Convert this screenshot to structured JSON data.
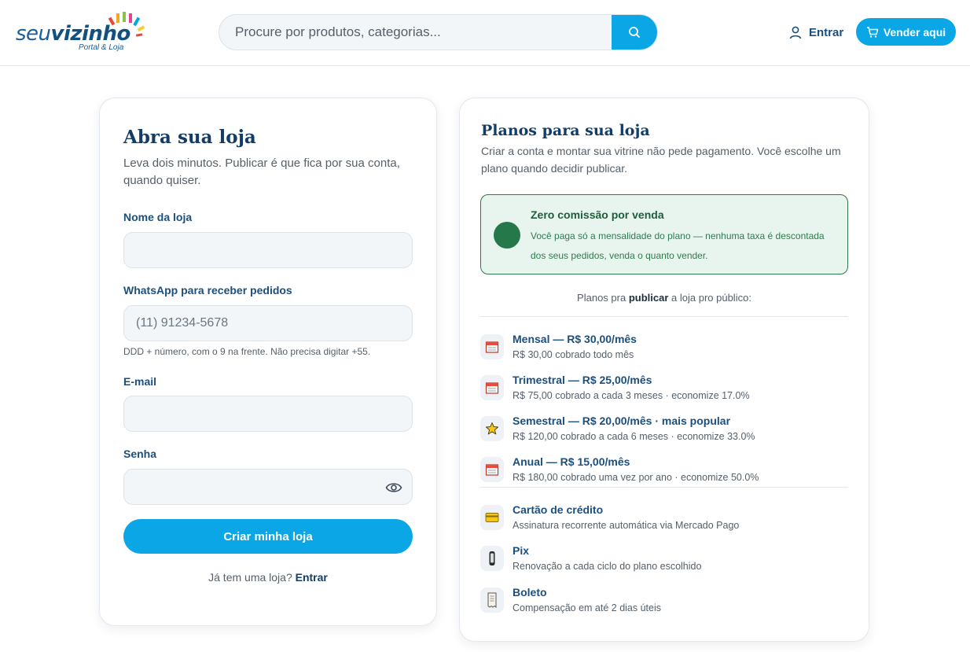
{
  "header": {
    "logo": {
      "part1": "seu",
      "part2": "vizinho",
      "sub": "Portal & Loja"
    },
    "search": {
      "placeholder": "Procure por produtos, categorias..."
    },
    "login_label": "Entrar",
    "sell_label": "Vender aqui"
  },
  "signup": {
    "title": "Abra sua loja",
    "subtitle": "Leva dois minutos. Publicar é que fica por sua conta, quando quiser.",
    "store_name_label": "Nome da loja",
    "whatsapp_label": "WhatsApp para receber pedidos",
    "whatsapp_placeholder": "(11) 91234-5678",
    "whatsapp_hint": "DDD + número, com o 9 na frente. Não precisa digitar +55.",
    "email_label": "E-mail",
    "password_label": "Senha",
    "submit_label": "Criar minha loja",
    "have_store_text": "Já tem uma loja?",
    "have_store_link": "Entrar"
  },
  "plans": {
    "title": "Planos para sua loja",
    "subtitle": "Criar a conta e montar sua vitrine não pede pagamento. Você escolhe um plano quando decidir publicar.",
    "promo": {
      "title": "Zero comissão por venda",
      "text": "Você paga só a mensalidade do plano — nenhuma taxa é descontada dos seus pedidos, venda o quanto vender."
    },
    "caption_pre": "Planos pra",
    "caption_bold": "publicar",
    "caption_post": "a loja pro público:",
    "items": [
      {
        "title": "Mensal — R$ 30,00/mês",
        "desc": "R$ 30,00 cobrado todo mês",
        "icon": "calendar-icon"
      },
      {
        "title": "Trimestral — R$ 25,00/mês",
        "desc": "R$ 75,00 cobrado a cada 3 meses · economize 17.0%",
        "icon": "calendar-icon"
      },
      {
        "title": "Semestral — R$ 20,00/mês · mais popular",
        "desc": "R$ 120,00 cobrado a cada 6 meses · economize 33.0%",
        "icon": "star-icon"
      },
      {
        "title": "Anual — R$ 15,00/mês",
        "desc": "R$ 180,00 cobrado uma vez por ano · economize 50.0%",
        "icon": "calendar-icon"
      }
    ],
    "payments": [
      {
        "title": "Cartão de crédito",
        "desc": "Assinatura recorrente automática via Mercado Pago",
        "icon": "credit-card-icon"
      },
      {
        "title": "Pix",
        "desc": "Renovação a cada ciclo do plano escolhido",
        "icon": "phone-icon"
      },
      {
        "title": "Boleto",
        "desc": "Compensação em até 2 dias úteis",
        "icon": "receipt-icon"
      }
    ]
  },
  "colors": {
    "accent": "#0aa6e6",
    "navy": "#133d66",
    "promo_green": "#24784a",
    "promo_bg": "#e8f5ee"
  }
}
